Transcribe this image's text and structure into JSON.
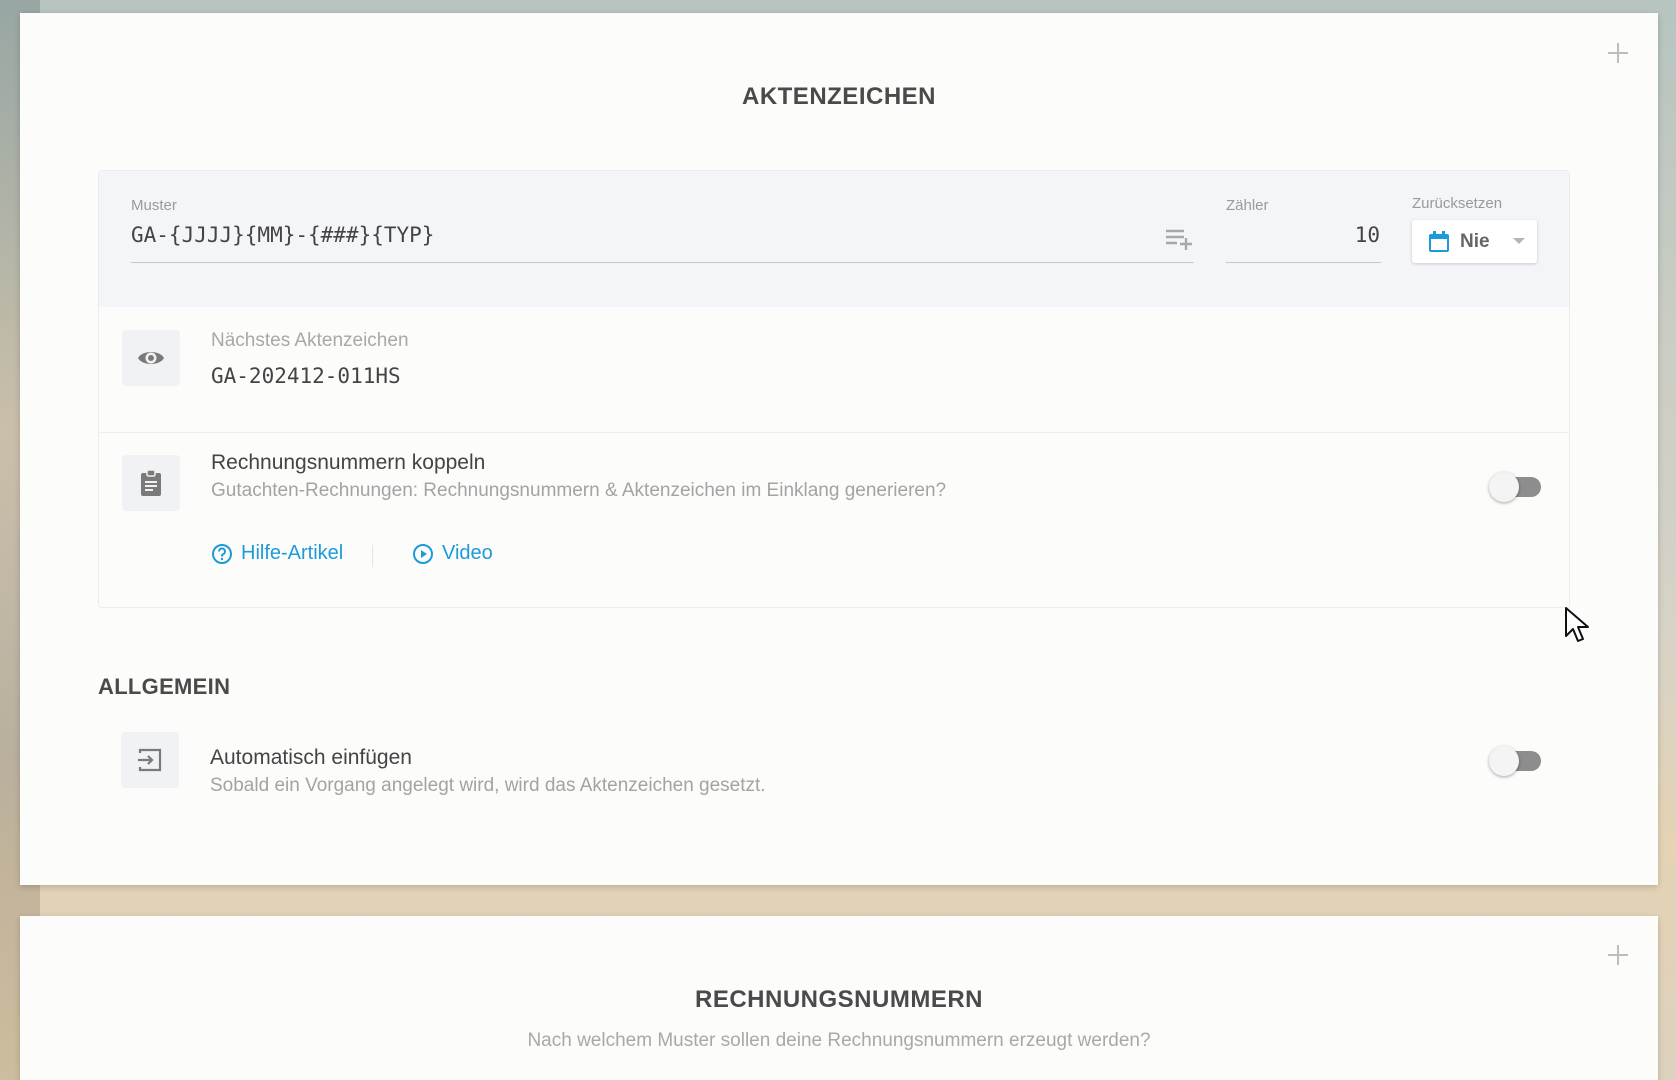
{
  "aktenzeichen_card": {
    "title": "AKTENZEICHEN",
    "muster": {
      "label": "Muster",
      "value": "GA-{JJJJ}{MM}-{###}{TYP}"
    },
    "zaehler": {
      "label": "Zähler",
      "value": "10"
    },
    "zuruecksetzen": {
      "label": "Zurücksetzen",
      "value": "Nie"
    },
    "next": {
      "label": "Nächstes Aktenzeichen",
      "value": "GA-202412-011HS"
    },
    "coupling": {
      "title": "Rechnungsnummern koppeln",
      "description": "Gutachten-Rechnungen: Rechnungsnummern & Aktenzeichen im Einklang generieren?",
      "enabled": false,
      "links": {
        "help": "Hilfe-Artikel",
        "video": "Video"
      }
    },
    "general": {
      "heading": "ALLGEMEIN",
      "auto_insert": {
        "title": "Automatisch einfügen",
        "description": "Sobald ein Vorgang angelegt wird, wird das Aktenzeichen gesetzt.",
        "enabled": false
      }
    }
  },
  "rechnungsnummern_card": {
    "title": "RECHNUNGSNUMMERN",
    "subtitle": "Nach welchem Muster sollen deine Rechnungsnummern erzeugt werden?"
  },
  "icons": {
    "card_add": "plus-icon",
    "insert": "playlist-add-icon",
    "calendar": "calendar-icon",
    "next": "eye-icon",
    "coupling": "clipboard-icon",
    "help": "help-circle-icon",
    "video": "play-circle-icon",
    "auto_insert": "input-icon"
  },
  "colors": {
    "accent": "#1d9bd9",
    "toggle_off": "#8d8d8d"
  }
}
